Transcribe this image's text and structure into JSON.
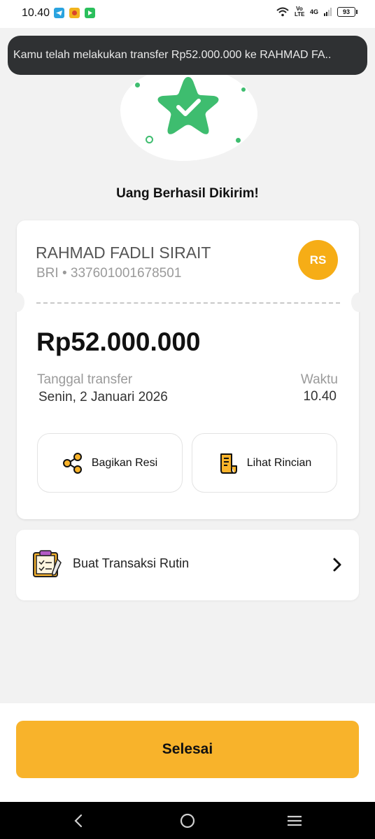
{
  "status_bar": {
    "time": "10.40",
    "network": "4G",
    "volte": "Vo LTE",
    "battery": "93",
    "icons": [
      "telegram-icon",
      "game-app-icon",
      "green-app-icon",
      "wifi-icon",
      "signal-icon",
      "battery-icon"
    ]
  },
  "toast": {
    "message": "Kamu telah melakukan transfer Rp52.000.000 ke RAHMAD FA.."
  },
  "colors": {
    "accent": "#f8b32b",
    "avatar": "#f6ad16",
    "success": "#3ebd6f"
  },
  "headline": "Uang Berhasil Dikirim!",
  "recipient": {
    "name": "RAHMAD FADLI SIRAIT",
    "bank_account": "BRI • 337601001678501",
    "initials": "RS"
  },
  "transfer": {
    "amount": "Rp52.000.000",
    "date_label": "Tanggal transfer",
    "date_value": "Senin, 2 Januari 2026",
    "time_label": "Waktu",
    "time_value": "10.40"
  },
  "actions": {
    "share_label": "Bagikan Resi",
    "details_label": "Lihat Rincian"
  },
  "routine": {
    "label": "Buat Transaksi Rutin"
  },
  "footer": {
    "done_label": "Selesai"
  }
}
